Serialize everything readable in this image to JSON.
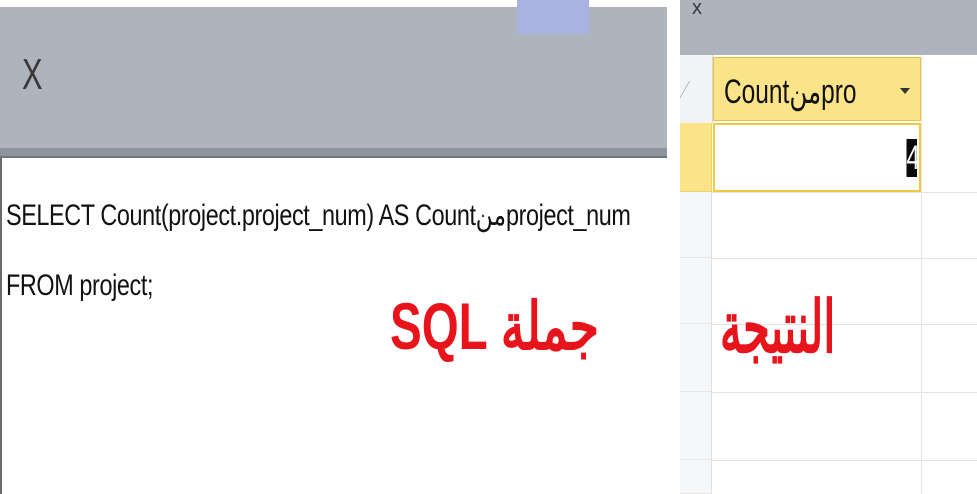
{
  "sql_view": {
    "close_label": "X",
    "sql_lines": [
      "SELECT Count(project.project_num) AS Countمنproject_num",
      "FROM project;"
    ],
    "caption": "جملة SQL"
  },
  "result_view": {
    "close_label": "x",
    "column_header": "Countمنpro",
    "cell_value": "4",
    "caption": "النتيجة"
  },
  "colors": {
    "titlebar": "#aeb4bd",
    "header_highlight": "#fbe38a",
    "caption_red": "#e8141c"
  }
}
